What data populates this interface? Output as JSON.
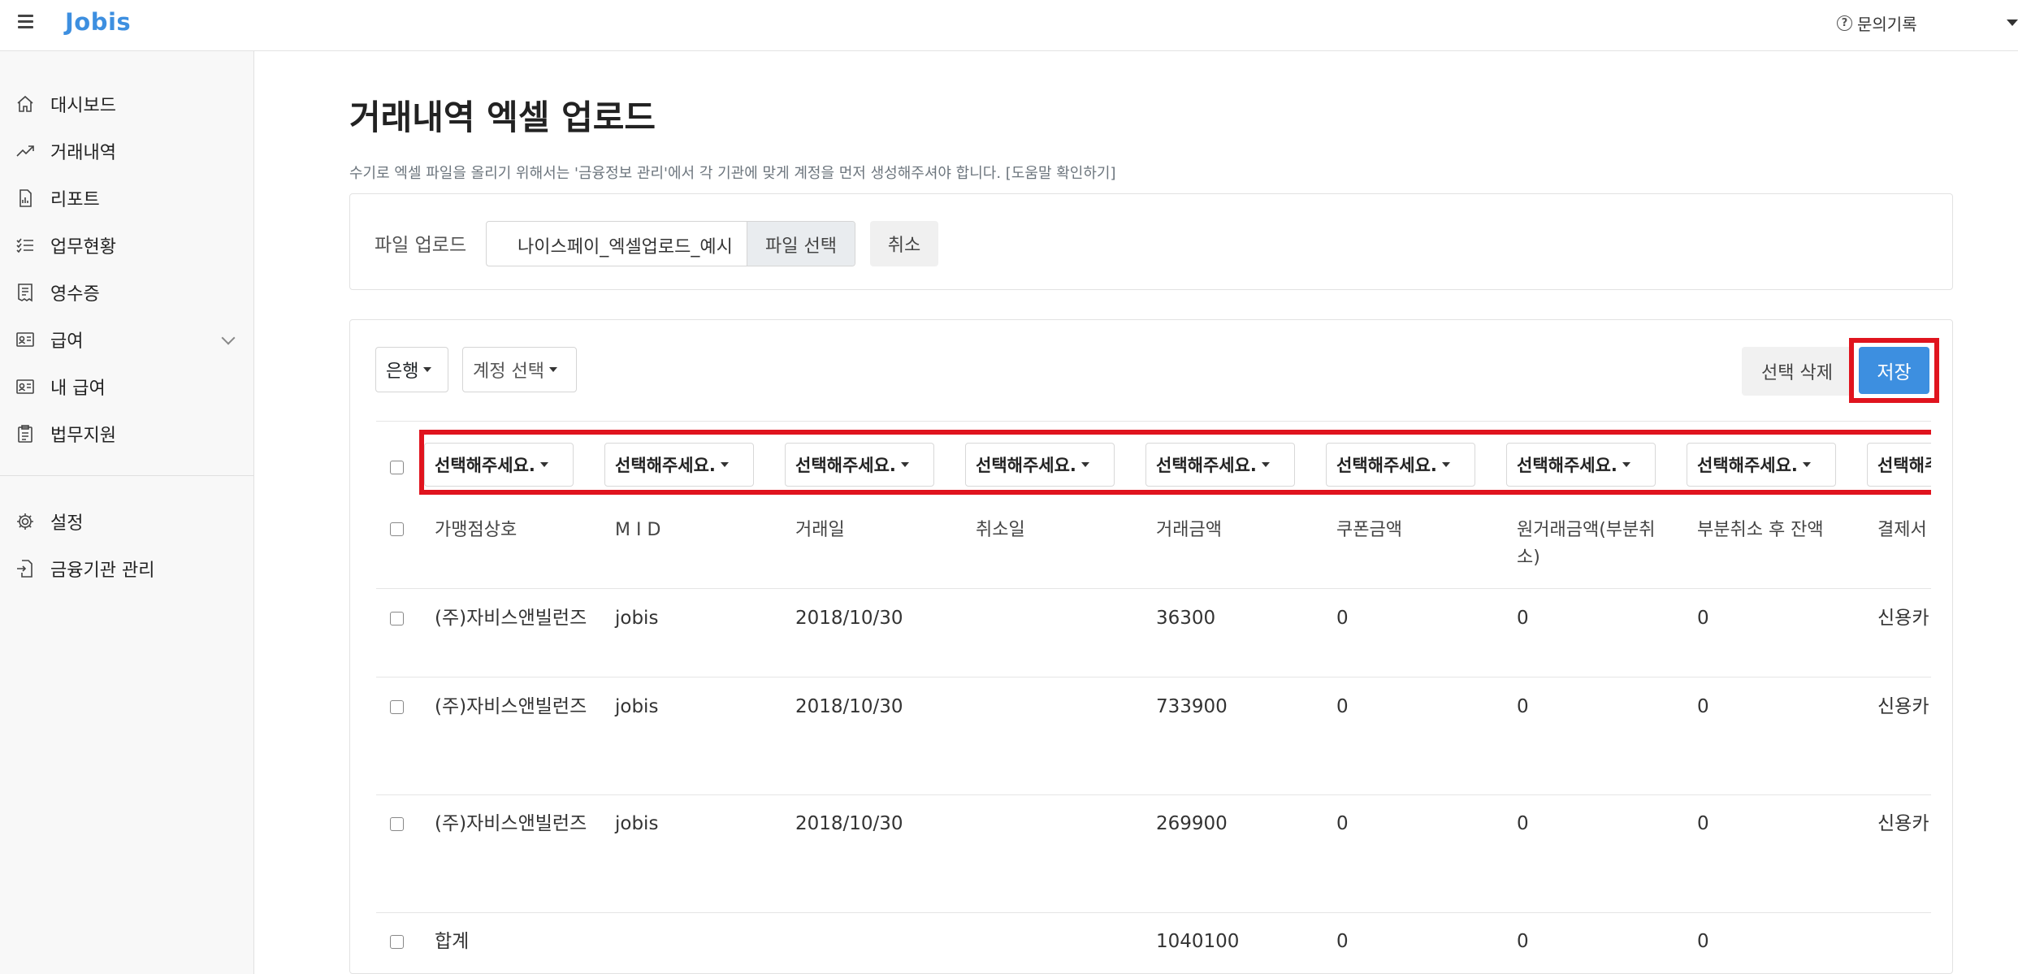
{
  "topbar": {
    "logo": "Jobis",
    "inquiry_label": "문의기록"
  },
  "sidebar": {
    "items": [
      {
        "label": "대시보드",
        "icon": "home-icon"
      },
      {
        "label": "거래내역",
        "icon": "chart-line-icon"
      },
      {
        "label": "리포트",
        "icon": "report-icon"
      },
      {
        "label": "업무현황",
        "icon": "checklist-icon"
      },
      {
        "label": "영수증",
        "icon": "receipt-icon"
      },
      {
        "label": "급여",
        "icon": "id-card-icon"
      },
      {
        "label": "내 급여",
        "icon": "id-card-icon"
      },
      {
        "label": "법무지원",
        "icon": "clipboard-icon"
      },
      {
        "label": "설정",
        "icon": "gear-icon"
      },
      {
        "label": "금융기관 관리",
        "icon": "import-icon"
      }
    ]
  },
  "main": {
    "title": "거래내역 엑셀 업로드",
    "notice": "수기로 엑셀 파일을 올리기 위해서는 '금융정보 관리'에서 각 기관에 맞게 계정을 먼저 생성해주셔야 합니다. [도움말 확인하기]",
    "upload": {
      "label": "파일 업로드",
      "file_name": "나이스페이_엑셀업로드_예시",
      "choose_label": "파일 선택",
      "cancel_label": "취소"
    },
    "toolbar": {
      "bank_label": "은행",
      "account_label": "계정 선택",
      "delete_label": "선택 삭제",
      "save_label": "저장"
    },
    "column_select_placeholder": "선택해주세요.",
    "table": {
      "headers": [
        "가맹점상호",
        "M I D",
        "거래일",
        "취소일",
        "거래금액",
        "쿠폰금액",
        "원거래금액(부분취소)",
        "부분취소 후 잔액",
        "결제서"
      ],
      "rows": [
        [
          "(주)자비스앤빌런즈",
          "jobis",
          "2018/10/30",
          "",
          "36300",
          "0",
          "0",
          "0",
          "신용카"
        ],
        [
          "(주)자비스앤빌런즈",
          "jobis",
          "2018/10/30",
          "",
          "733900",
          "0",
          "0",
          "0",
          "신용카"
        ],
        [
          "(주)자비스앤빌런즈",
          "jobis",
          "2018/10/30",
          "",
          "269900",
          "0",
          "0",
          "0",
          "신용카"
        ]
      ],
      "total": [
        "합계",
        "",
        "",
        "",
        "1040100",
        "0",
        "0",
        "0",
        ""
      ]
    }
  },
  "colors": {
    "accent": "#3d8fe0",
    "highlight": "#e0141e"
  }
}
